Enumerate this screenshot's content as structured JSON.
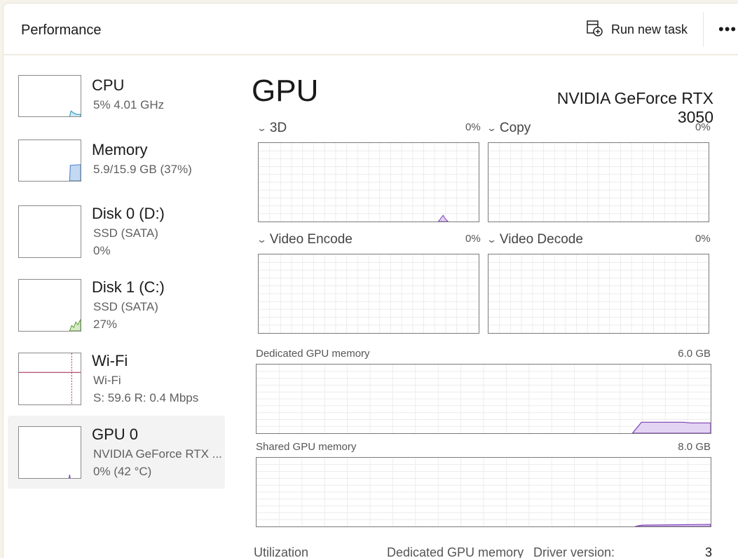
{
  "header": {
    "title": "Performance",
    "run_new_task": "Run new task",
    "more": "•••"
  },
  "sidebar": {
    "items": [
      {
        "name": "CPU",
        "line1": "5%  4.01 GHz",
        "line2": "",
        "line3": "",
        "color": "#1a8fb3",
        "value_percent": 5
      },
      {
        "name": "Memory",
        "line1": "5.9/15.9 GB (37%)",
        "line2": "",
        "line3": "",
        "color": "#3b78c9",
        "value_percent": 37
      },
      {
        "name": "Disk 0 (D:)",
        "line1": "SSD (SATA)",
        "line2": "0%",
        "line3": "",
        "color": "#4f9a2b",
        "value_percent": 0
      },
      {
        "name": "Disk 1 (C:)",
        "line1": "SSD (SATA)",
        "line2": "27%",
        "line3": "",
        "color": "#4f9a2b",
        "value_percent": 27
      },
      {
        "name": "Wi-Fi",
        "line1": "Wi-Fi",
        "line2": "S: 59.6  R: 0.4 Mbps",
        "line3": "",
        "color": "#a01c4e"
      },
      {
        "name": "GPU 0",
        "line1": "NVIDIA GeForce RTX ...",
        "line2": "0%  (42 °C)",
        "line3": "",
        "color": "#7b3fb5",
        "value_percent": 0,
        "selected": true
      }
    ]
  },
  "main": {
    "title": "GPU",
    "model": "NVIDIA GeForce RTX 3050",
    "engines": [
      {
        "label": "3D",
        "percent": "0%"
      },
      {
        "label": "Copy",
        "percent": "0%"
      },
      {
        "label": "Video Encode",
        "percent": "0%"
      },
      {
        "label": "Video Decode",
        "percent": "0%"
      }
    ],
    "dedicated_memory": {
      "label": "Dedicated GPU memory",
      "max": "6.0 GB"
    },
    "shared_memory": {
      "label": "Shared GPU memory",
      "max": "8.0 GB"
    },
    "stats": {
      "utilization": "Utilization",
      "dedicated_memory": "Dedicated GPU memory",
      "driver_version": "Driver version:",
      "driver_value": "3"
    }
  },
  "colors": {
    "gpu": "#7b3fb5",
    "gpu_fill": "#e4d4f4",
    "grid": "#ececec"
  }
}
